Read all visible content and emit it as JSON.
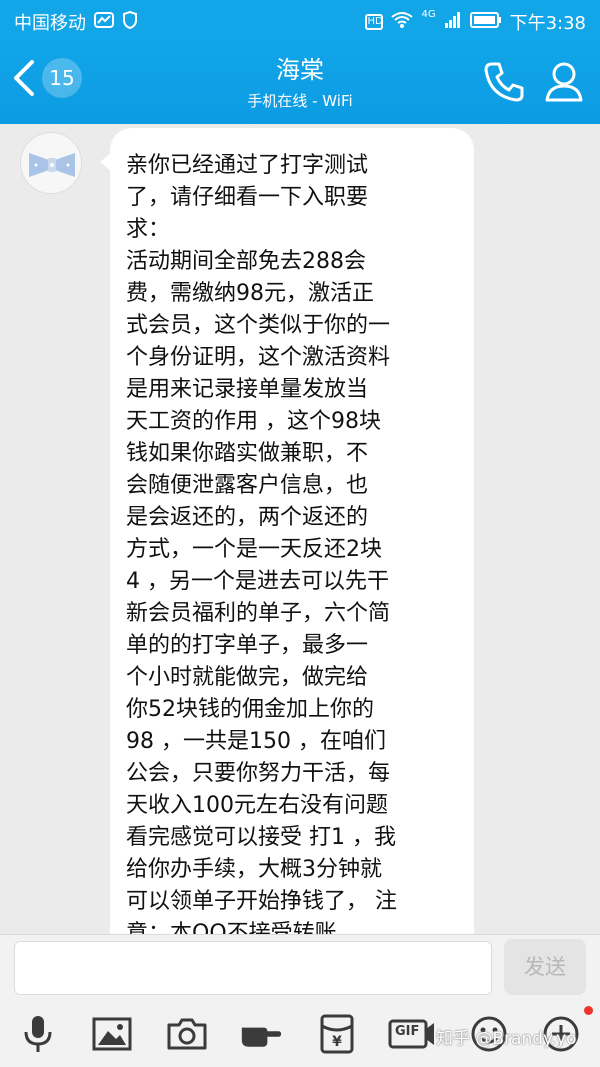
{
  "status_bar": {
    "carrier": "中国移动",
    "network": "4G",
    "hd": "HD",
    "time": "下午3:38"
  },
  "header": {
    "back_count": "15",
    "contact_name": "海棠",
    "status": "手机在线 - WiFi",
    "icons": [
      "back-chevron-icon",
      "phone-icon",
      "profile-icon"
    ]
  },
  "message": {
    "lines": [
      "亲你已经通过了打字测试",
      "了，请仔细看一下入职要",
      "求：",
      "活动期间全部免去288会",
      "费，需缴纳98元，激活正",
      "式会员，这个类似于你的一",
      "个身份证明，这个激活资料",
      "是用来记录接单量发放当",
      "天工资的作用 ，这个98块",
      "钱如果你踏实做兼职，不",
      "会随便泄露客户信息，也",
      "是会返还的，两个返还的",
      "方式，一个是一天反还2块",
      "4 ，另一个是进去可以先干",
      "新会员福利的单子，六个简",
      "单的的打字单子，最多一",
      "个小时就能做完，做完给",
      "你52块钱的佣金加上你的",
      "98 ，一共是150 ，在咱们",
      "公会，只要你努力干活，每",
      "天收入100元左右没有问题",
      "看完感觉可以接受 打1 ，我",
      "给你办手续，大概3分钟就",
      "可以领单子开始挣钱了， 注",
      "意；本QQ不接受转账"
    ]
  },
  "input": {
    "value": "",
    "send_label": "发送"
  },
  "toolbar": {
    "icons": [
      "microphone-icon",
      "image-icon",
      "camera-icon",
      "hand-icon",
      "red-packet-icon",
      "gif-icon",
      "emoji-icon",
      "plus-icon"
    ],
    "gif_label": "GIF"
  },
  "watermark": "知乎 @Brandy.yo",
  "colors": {
    "accent": "#12a5e8",
    "chat_bg": "#ebebeb",
    "bubble": "#ffffff",
    "notification_dot": "#f0342c"
  }
}
